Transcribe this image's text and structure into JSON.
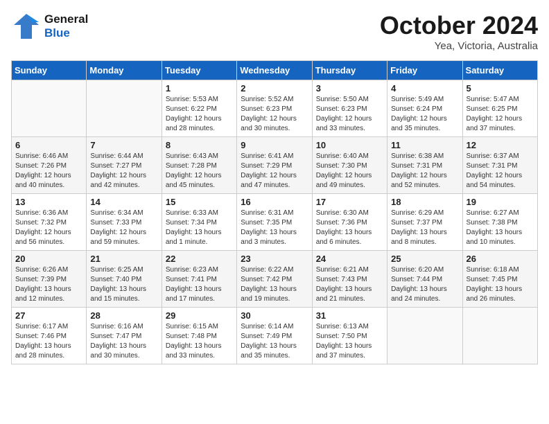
{
  "header": {
    "logo_line1": "General",
    "logo_line2": "Blue",
    "month_title": "October 2024",
    "subtitle": "Yea, Victoria, Australia"
  },
  "days_of_week": [
    "Sunday",
    "Monday",
    "Tuesday",
    "Wednesday",
    "Thursday",
    "Friday",
    "Saturday"
  ],
  "weeks": [
    [
      {
        "day": "",
        "info": ""
      },
      {
        "day": "",
        "info": ""
      },
      {
        "day": "1",
        "info": "Sunrise: 5:53 AM\nSunset: 6:22 PM\nDaylight: 12 hours and 28 minutes."
      },
      {
        "day": "2",
        "info": "Sunrise: 5:52 AM\nSunset: 6:23 PM\nDaylight: 12 hours and 30 minutes."
      },
      {
        "day": "3",
        "info": "Sunrise: 5:50 AM\nSunset: 6:23 PM\nDaylight: 12 hours and 33 minutes."
      },
      {
        "day": "4",
        "info": "Sunrise: 5:49 AM\nSunset: 6:24 PM\nDaylight: 12 hours and 35 minutes."
      },
      {
        "day": "5",
        "info": "Sunrise: 5:47 AM\nSunset: 6:25 PM\nDaylight: 12 hours and 37 minutes."
      }
    ],
    [
      {
        "day": "6",
        "info": "Sunrise: 6:46 AM\nSunset: 7:26 PM\nDaylight: 12 hours and 40 minutes."
      },
      {
        "day": "7",
        "info": "Sunrise: 6:44 AM\nSunset: 7:27 PM\nDaylight: 12 hours and 42 minutes."
      },
      {
        "day": "8",
        "info": "Sunrise: 6:43 AM\nSunset: 7:28 PM\nDaylight: 12 hours and 45 minutes."
      },
      {
        "day": "9",
        "info": "Sunrise: 6:41 AM\nSunset: 7:29 PM\nDaylight: 12 hours and 47 minutes."
      },
      {
        "day": "10",
        "info": "Sunrise: 6:40 AM\nSunset: 7:30 PM\nDaylight: 12 hours and 49 minutes."
      },
      {
        "day": "11",
        "info": "Sunrise: 6:38 AM\nSunset: 7:31 PM\nDaylight: 12 hours and 52 minutes."
      },
      {
        "day": "12",
        "info": "Sunrise: 6:37 AM\nSunset: 7:31 PM\nDaylight: 12 hours and 54 minutes."
      }
    ],
    [
      {
        "day": "13",
        "info": "Sunrise: 6:36 AM\nSunset: 7:32 PM\nDaylight: 12 hours and 56 minutes."
      },
      {
        "day": "14",
        "info": "Sunrise: 6:34 AM\nSunset: 7:33 PM\nDaylight: 12 hours and 59 minutes."
      },
      {
        "day": "15",
        "info": "Sunrise: 6:33 AM\nSunset: 7:34 PM\nDaylight: 13 hours and 1 minute."
      },
      {
        "day": "16",
        "info": "Sunrise: 6:31 AM\nSunset: 7:35 PM\nDaylight: 13 hours and 3 minutes."
      },
      {
        "day": "17",
        "info": "Sunrise: 6:30 AM\nSunset: 7:36 PM\nDaylight: 13 hours and 6 minutes."
      },
      {
        "day": "18",
        "info": "Sunrise: 6:29 AM\nSunset: 7:37 PM\nDaylight: 13 hours and 8 minutes."
      },
      {
        "day": "19",
        "info": "Sunrise: 6:27 AM\nSunset: 7:38 PM\nDaylight: 13 hours and 10 minutes."
      }
    ],
    [
      {
        "day": "20",
        "info": "Sunrise: 6:26 AM\nSunset: 7:39 PM\nDaylight: 13 hours and 12 minutes."
      },
      {
        "day": "21",
        "info": "Sunrise: 6:25 AM\nSunset: 7:40 PM\nDaylight: 13 hours and 15 minutes."
      },
      {
        "day": "22",
        "info": "Sunrise: 6:23 AM\nSunset: 7:41 PM\nDaylight: 13 hours and 17 minutes."
      },
      {
        "day": "23",
        "info": "Sunrise: 6:22 AM\nSunset: 7:42 PM\nDaylight: 13 hours and 19 minutes."
      },
      {
        "day": "24",
        "info": "Sunrise: 6:21 AM\nSunset: 7:43 PM\nDaylight: 13 hours and 21 minutes."
      },
      {
        "day": "25",
        "info": "Sunrise: 6:20 AM\nSunset: 7:44 PM\nDaylight: 13 hours and 24 minutes."
      },
      {
        "day": "26",
        "info": "Sunrise: 6:18 AM\nSunset: 7:45 PM\nDaylight: 13 hours and 26 minutes."
      }
    ],
    [
      {
        "day": "27",
        "info": "Sunrise: 6:17 AM\nSunset: 7:46 PM\nDaylight: 13 hours and 28 minutes."
      },
      {
        "day": "28",
        "info": "Sunrise: 6:16 AM\nSunset: 7:47 PM\nDaylight: 13 hours and 30 minutes."
      },
      {
        "day": "29",
        "info": "Sunrise: 6:15 AM\nSunset: 7:48 PM\nDaylight: 13 hours and 33 minutes."
      },
      {
        "day": "30",
        "info": "Sunrise: 6:14 AM\nSunset: 7:49 PM\nDaylight: 13 hours and 35 minutes."
      },
      {
        "day": "31",
        "info": "Sunrise: 6:13 AM\nSunset: 7:50 PM\nDaylight: 13 hours and 37 minutes."
      },
      {
        "day": "",
        "info": ""
      },
      {
        "day": "",
        "info": ""
      }
    ]
  ]
}
